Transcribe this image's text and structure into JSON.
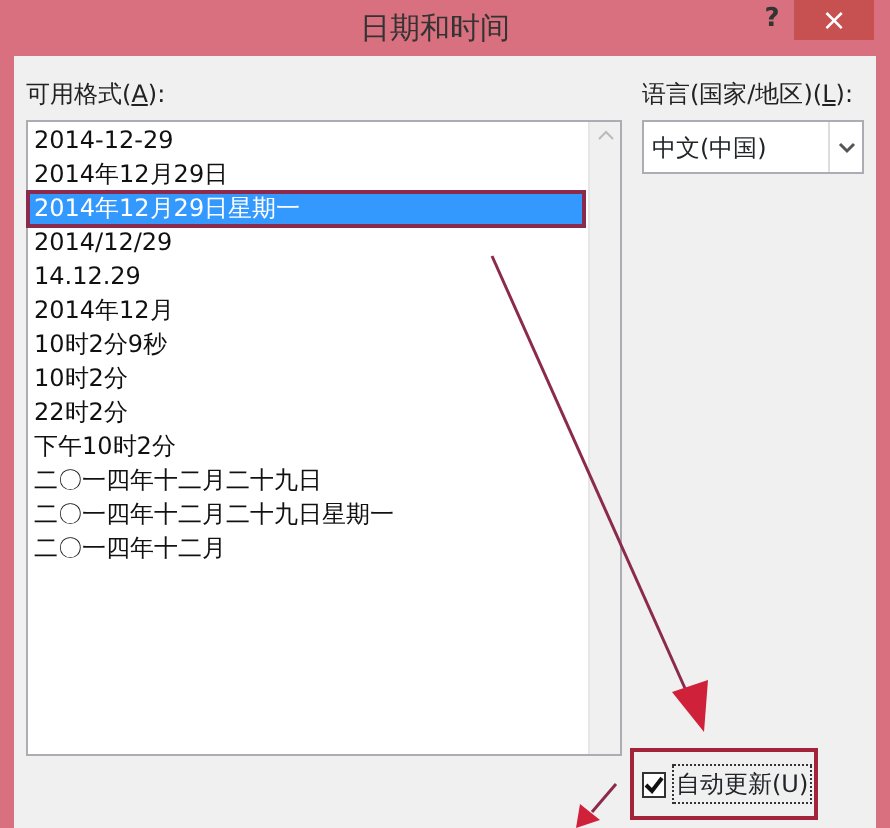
{
  "window": {
    "title": "日期和时间",
    "help": "?",
    "close": "×"
  },
  "formats": {
    "label": "可用格式(**A**):",
    "items": [
      {
        "text": "2014-12-29",
        "selected": false
      },
      {
        "text": "2014年12月29日",
        "selected": false
      },
      {
        "text": "2014年12月29日星期一",
        "selected": true
      },
      {
        "text": "2014/12/29",
        "selected": false
      },
      {
        "text": "14.12.29",
        "selected": false
      },
      {
        "text": "2014年12月",
        "selected": false
      },
      {
        "text": "10时2分9秒",
        "selected": false
      },
      {
        "text": "10时2分",
        "selected": false
      },
      {
        "text": "22时2分",
        "selected": false
      },
      {
        "text": "下午10时2分",
        "selected": false
      },
      {
        "text": "二〇一四年十二月二十九日",
        "selected": false
      },
      {
        "text": "二〇一四年十二月二十九日星期一",
        "selected": false
      },
      {
        "text": "二〇一四年十二月",
        "selected": false
      }
    ]
  },
  "language": {
    "label": "语言(国家/地区)(**L**):",
    "value": "中文(中国)"
  },
  "auto_update": {
    "label": "自动更新(U)",
    "checked": true
  }
}
